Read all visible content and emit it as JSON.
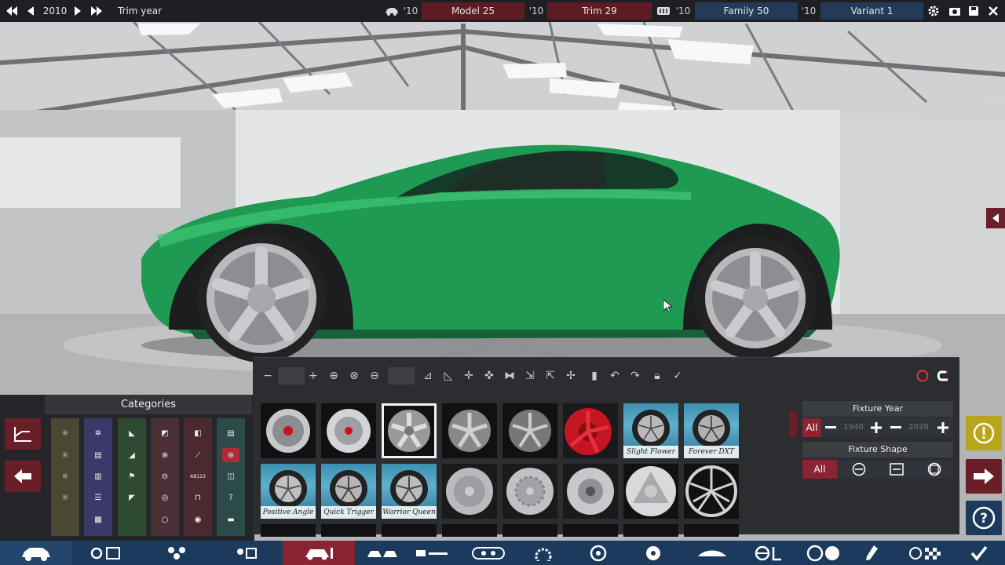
{
  "colors": {
    "accent_red": "#8a2433",
    "accent_blue": "#233a58",
    "car_green": "#1f9a52"
  },
  "topbar": {
    "year": "2010",
    "year_label": "Trim year",
    "model_year": "'10",
    "model_name": "Model 25",
    "trim_year": "'10",
    "trim_name": "Trim 29",
    "family_year": "'10",
    "family_name": "Family 50",
    "variant_year": "'10",
    "variant_name": "Variant 1",
    "icons": [
      "first-page-icon",
      "prev-icon",
      "next-icon",
      "last-page-icon",
      "car-icon",
      "grille-icon",
      "settings-icon",
      "camera-icon",
      "save-icon",
      "close-icon"
    ]
  },
  "categories": {
    "title": "Categories",
    "badge_text": "AB123"
  },
  "fixture_grid": {
    "labels": [
      "Slight Flower",
      "Forever DXT",
      "Positive Angle",
      "Quick Trigger",
      "Warrior Queen"
    ]
  },
  "filters": {
    "year_title": "Fixture Year",
    "year_all": "All",
    "year_from": "1940",
    "year_to": "2020",
    "shape_title": "Fixture Shape",
    "shape_all": "All"
  }
}
